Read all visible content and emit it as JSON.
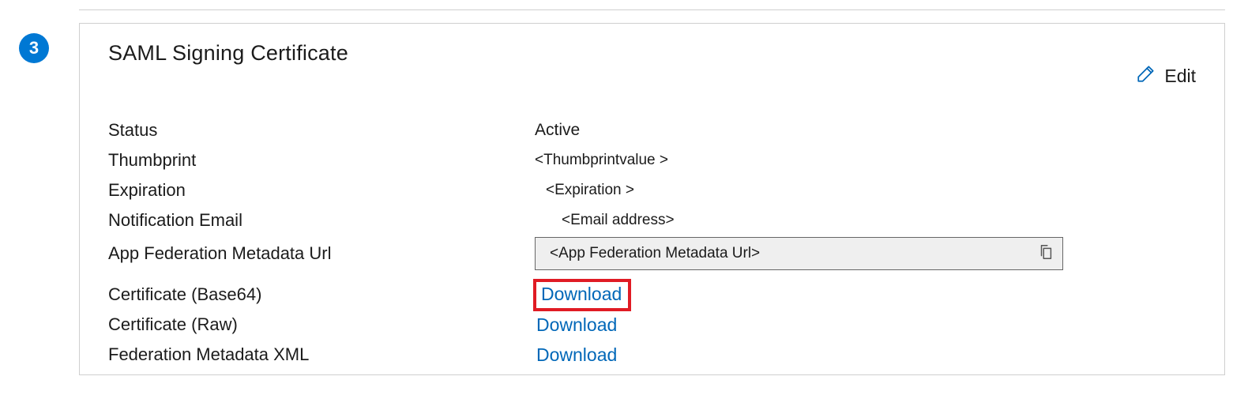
{
  "step": {
    "number": "3"
  },
  "card": {
    "title": "SAML Signing Certificate",
    "edit_label": "Edit",
    "fields": {
      "status_label": "Status",
      "status_value": "Active",
      "thumbprint_label": "Thumbprint",
      "thumbprint_value": "<Thumbprintvalue >",
      "expiration_label": "Expiration",
      "expiration_value": "<Expiration >",
      "notification_email_label": "Notification Email",
      "notification_email_value": "<Email address>",
      "app_fed_url_label": "App Federation Metadata Url",
      "app_fed_url_value": "<App Federation Metadata Url>",
      "cert_base64_label": "Certificate (Base64)",
      "cert_base64_action": "Download",
      "cert_raw_label": "Certificate (Raw)",
      "cert_raw_action": "Download",
      "fed_metadata_xml_label": "Federation Metadata XML",
      "fed_metadata_xml_action": "Download"
    }
  }
}
